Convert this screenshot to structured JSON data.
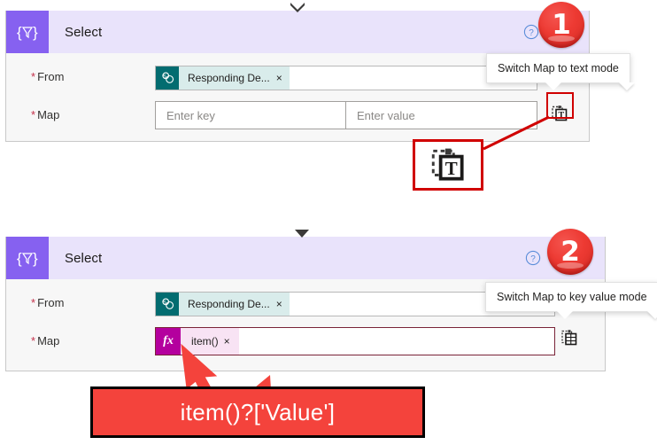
{
  "page": {
    "background_color": "#ffffff",
    "annotation_color": "#d00000",
    "badge_color": "#ed3a33",
    "accent_purple": "#8661f0",
    "header_bg": "#e9e3fb"
  },
  "connectors": [
    {
      "name": "flow-chevron-top",
      "glyph": "chevron-down-icon"
    },
    {
      "name": "flow-chevron-middle",
      "glyph": "chevron-down-icon"
    }
  ],
  "cards": [
    {
      "step_number": "1",
      "icon_name": "select-action-icon",
      "title": "Select",
      "help_icon": "help-circle-icon",
      "fields": {
        "from": {
          "label": "From",
          "required_marker": "*",
          "token": {
            "logo_name": "sharepoint-icon",
            "text": "Responding De...",
            "remove_label": "×"
          }
        },
        "map": {
          "label": "Map",
          "required_marker": "*",
          "mode": "key-value",
          "key_placeholder": "Enter key",
          "value_placeholder": "Enter value",
          "key_value": "",
          "value_value": "",
          "toggle_icon_name": "switch-to-text-mode-icon",
          "toggle_tooltip": "Switch Map to text mode"
        }
      }
    },
    {
      "step_number": "2",
      "icon_name": "select-action-icon",
      "title": "Select",
      "help_icon": "help-circle-icon",
      "fields": {
        "from": {
          "label": "From",
          "required_marker": "*",
          "token": {
            "logo_name": "sharepoint-icon",
            "text": "Responding De...",
            "remove_label": "×"
          }
        },
        "map": {
          "label": "Map",
          "required_marker": "*",
          "mode": "text",
          "expression_badge": "fx",
          "expression_text": "item()",
          "remove_label": "×",
          "toggle_icon_name": "switch-to-key-value-mode-icon",
          "toggle_tooltip": "Switch Map to key value mode"
        }
      }
    }
  ],
  "annotations": {
    "zoom_callout": {
      "name": "zoomed-text-mode-icon",
      "icon_name": "switch-to-text-mode-icon-magnified"
    },
    "red_callout": {
      "text": "item()?['Value']"
    },
    "arrow_to_token": {
      "name": "red-pointer-arrow"
    },
    "leader_line": {
      "name": "red-leader-line"
    }
  }
}
